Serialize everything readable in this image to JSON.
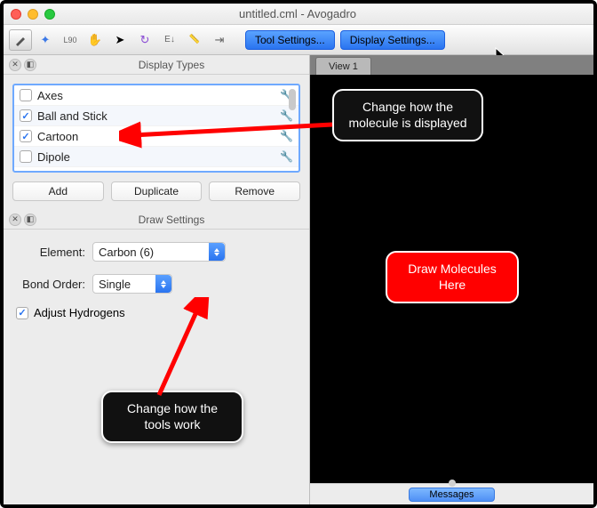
{
  "window": {
    "title": "untitled.cml - Avogadro"
  },
  "toolbar": {
    "tool_settings": "Tool Settings...",
    "display_settings": "Display Settings..."
  },
  "panels": {
    "display_types": {
      "title": "Display Types",
      "items": [
        {
          "label": "Axes",
          "checked": false
        },
        {
          "label": "Ball and Stick",
          "checked": true
        },
        {
          "label": "Cartoon",
          "checked": true
        },
        {
          "label": "Dipole",
          "checked": false
        }
      ],
      "buttons": {
        "add": "Add",
        "duplicate": "Duplicate",
        "remove": "Remove"
      }
    },
    "draw_settings": {
      "title": "Draw Settings",
      "element_label": "Element:",
      "element_value": "Carbon (6)",
      "bond_label": "Bond Order:",
      "bond_value": "Single",
      "adjust_h": "Adjust Hydrogens",
      "adjust_h_checked": true
    }
  },
  "view": {
    "tab": "View 1",
    "messages": "Messages"
  },
  "callouts": {
    "display": "Change how the molecule is displayed",
    "draw": "Draw Molecules Here",
    "tools": "Change how the tools work"
  }
}
